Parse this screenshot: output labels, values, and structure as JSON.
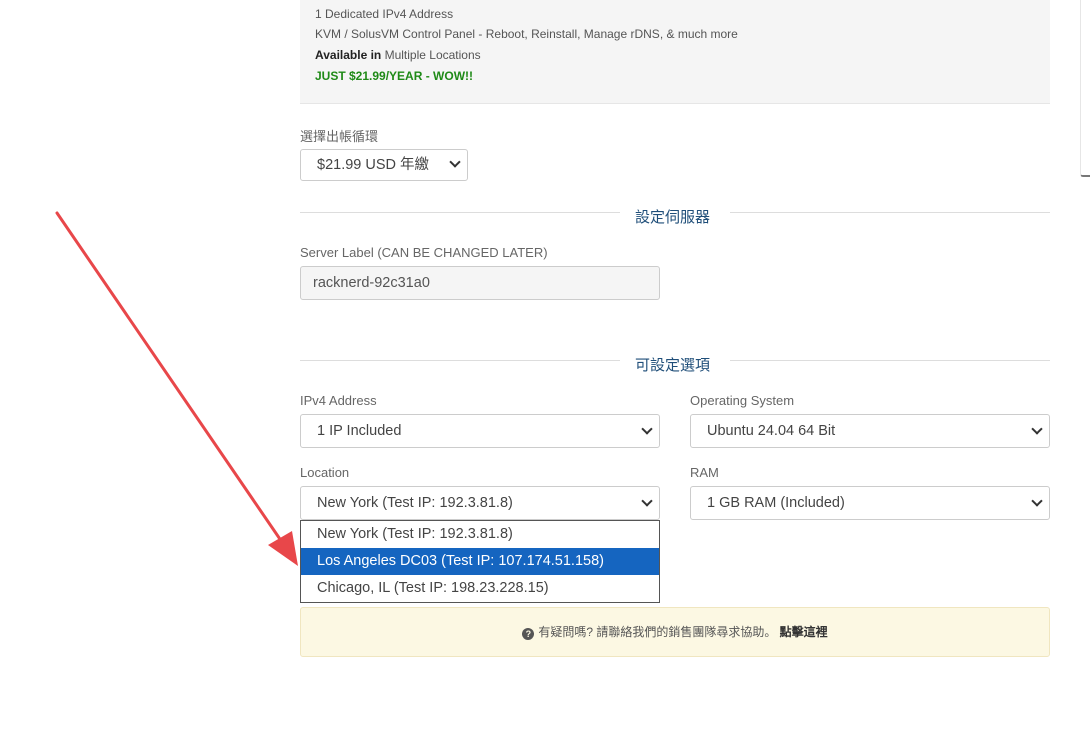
{
  "product": {
    "line1": "1 Dedicated IPv4 Address",
    "line2": "KVM / SolusVM Control Panel - Reboot, Reinstall, Manage rDNS, & much more",
    "available_label": "Available in",
    "available_value": " Multiple Locations",
    "promo": "JUST $21.99/YEAR - WOW!!"
  },
  "billing": {
    "label": "選擇出帳循環",
    "value": "$21.99 USD 年繳"
  },
  "server_section": {
    "title": "設定伺服器",
    "label_field_label": "Server Label (CAN BE CHANGED LATER)",
    "label_field_value": "racknerd-92c31a0"
  },
  "options_section": {
    "title": "可設定選項",
    "ipv4": {
      "label": "IPv4 Address",
      "value": "1 IP Included"
    },
    "os": {
      "label": "Operating System",
      "value": "Ubuntu 24.04 64 Bit"
    },
    "location": {
      "label": "Location",
      "value": "New York (Test IP: 192.3.81.8)",
      "options": [
        "New York (Test IP: 192.3.81.8)",
        "Los Angeles DC03 (Test IP: 107.174.51.158)",
        "Chicago, IL (Test IP: 198.23.228.15)"
      ],
      "highlighted_index": 1
    },
    "ram": {
      "label": "RAM",
      "value": "1 GB RAM (Included)"
    }
  },
  "help": {
    "icon": "question-circle-icon",
    "text": "有疑問嗎? 請聯絡我們的銷售團隊尋求協助。",
    "link": "點擊這裡"
  },
  "colors": {
    "accent_title": "#1f4e79",
    "promo_green": "#1f8a17",
    "highlight_blue": "#1565c0",
    "annotation_arrow": "#e8474a",
    "alert_bg": "#fcf8e3"
  }
}
